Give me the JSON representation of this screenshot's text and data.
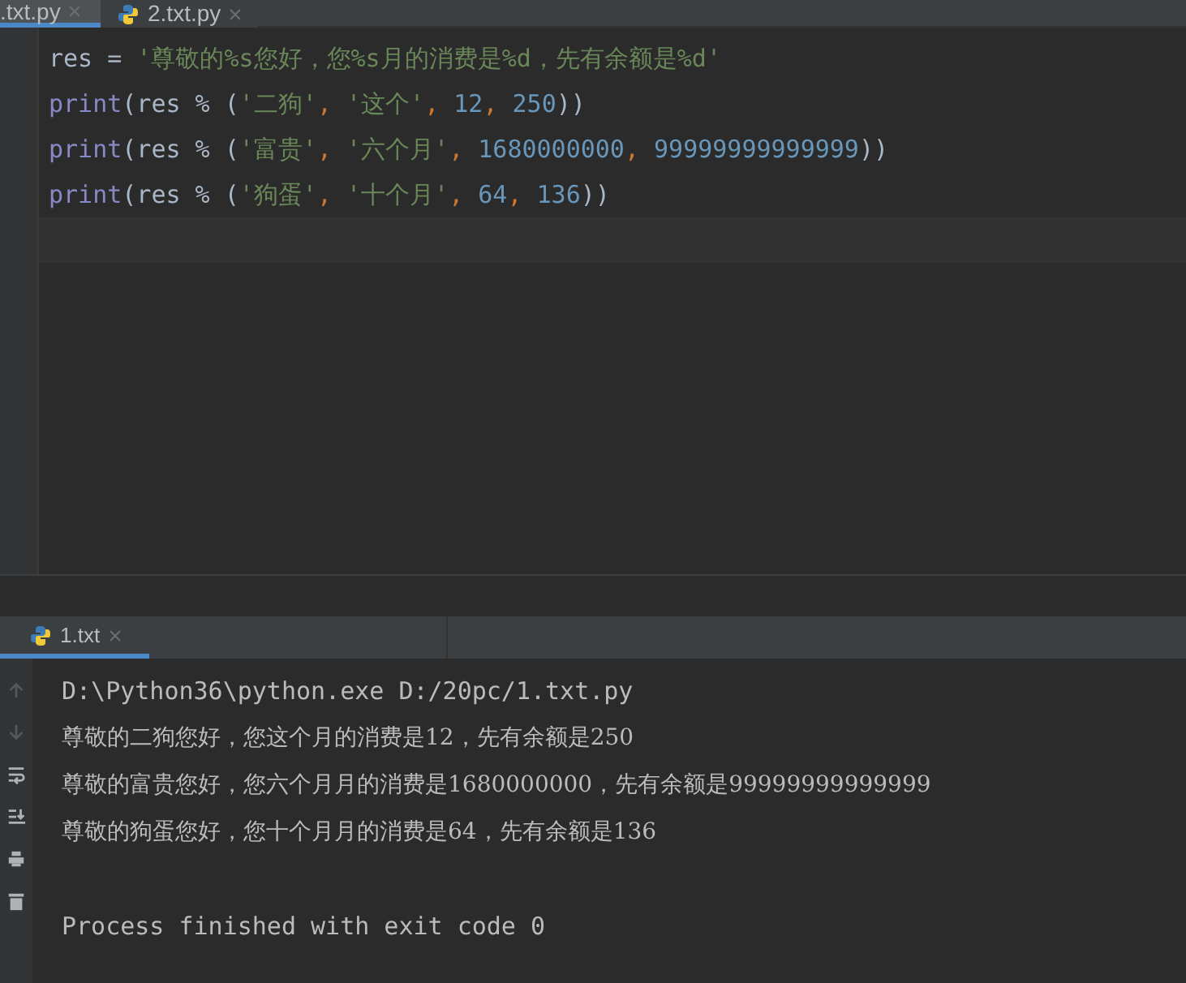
{
  "editor_tabs": [
    {
      "label": ".txt.py",
      "selected": true,
      "icon": false
    },
    {
      "label": "2.txt.py",
      "selected": false,
      "icon": true
    }
  ],
  "code_lines": [
    [
      {
        "kind": "ident",
        "text": "res = "
      },
      {
        "kind": "string",
        "text": "'尊敬的%s您好，您%s月的消费是%d，先有余额是%d'"
      }
    ],
    [
      {
        "kind": "builtin",
        "text": "print"
      },
      {
        "kind": "ident",
        "text": "(res % ("
      },
      {
        "kind": "string",
        "text": "'二狗'"
      },
      {
        "kind": "comma",
        "text": ", "
      },
      {
        "kind": "string",
        "text": "'这个'"
      },
      {
        "kind": "comma",
        "text": ", "
      },
      {
        "kind": "number",
        "text": "12"
      },
      {
        "kind": "comma",
        "text": ", "
      },
      {
        "kind": "number",
        "text": "250"
      },
      {
        "kind": "ident",
        "text": "))"
      }
    ],
    [
      {
        "kind": "builtin",
        "text": "print"
      },
      {
        "kind": "ident",
        "text": "(res % ("
      },
      {
        "kind": "string",
        "text": "'富贵'"
      },
      {
        "kind": "comma",
        "text": ", "
      },
      {
        "kind": "string",
        "text": "'六个月'"
      },
      {
        "kind": "comma",
        "text": ", "
      },
      {
        "kind": "number",
        "text": "1680000000"
      },
      {
        "kind": "comma",
        "text": ", "
      },
      {
        "kind": "number",
        "text": "99999999999999"
      },
      {
        "kind": "ident",
        "text": "))"
      }
    ],
    [
      {
        "kind": "builtin",
        "text": "print"
      },
      {
        "kind": "ident",
        "text": "(res % ("
      },
      {
        "kind": "string",
        "text": "'狗蛋'"
      },
      {
        "kind": "comma",
        "text": ", "
      },
      {
        "kind": "string",
        "text": "'十个月'"
      },
      {
        "kind": "comma",
        "text": ", "
      },
      {
        "kind": "number",
        "text": "64"
      },
      {
        "kind": "comma",
        "text": ", "
      },
      {
        "kind": "number",
        "text": "136"
      },
      {
        "kind": "ident",
        "text": "))"
      }
    ]
  ],
  "run_tabs": [
    {
      "label": "1.txt",
      "selected": true
    }
  ],
  "console_tools": [
    {
      "kind": "up",
      "disabled": true
    },
    {
      "kind": "down",
      "disabled": true
    },
    {
      "kind": "wrap",
      "disabled": false
    },
    {
      "kind": "scroll-end",
      "disabled": false
    },
    {
      "kind": "print",
      "disabled": false
    },
    {
      "kind": "trash",
      "disabled": false
    }
  ],
  "console_lines": [
    {
      "kind": "command",
      "text": "D:\\Python36\\python.exe D:/20pc/1.txt.py"
    },
    {
      "kind": "output",
      "text": "尊敬的二狗您好，您这个月的消费是12，先有余额是250"
    },
    {
      "kind": "output",
      "text": "尊敬的富贵您好，您六个月月的消费是1680000000，先有余额是99999999999999"
    },
    {
      "kind": "output",
      "text": "尊敬的狗蛋您好，您十个月月的消费是64，先有余额是136"
    },
    {
      "kind": "blank"
    },
    {
      "kind": "status",
      "text": "Process finished with exit code 0"
    }
  ]
}
